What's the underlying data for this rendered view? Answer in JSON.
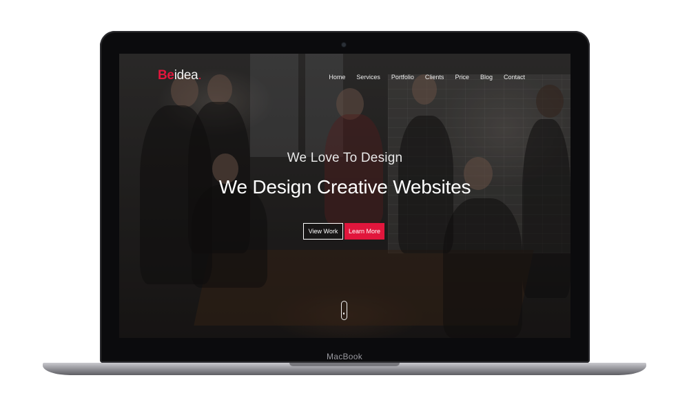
{
  "device": {
    "label": "MacBook"
  },
  "site": {
    "logo": {
      "accent": "Be",
      "rest": "idea",
      "dot": "."
    },
    "nav": [
      "Home",
      "Services",
      "Portfolio",
      "Clients",
      "Price",
      "Blog",
      "Contact"
    ],
    "hero": {
      "subtitle": "We Love To Design",
      "title": "We Design Creative Websites",
      "primary_button": "View Work",
      "secondary_button": "Learn More"
    }
  },
  "colors": {
    "accent": "#e1163c",
    "frame": "#0b0b0d",
    "text": "#ffffff"
  },
  "icons": {
    "scroll": "mouse-scroll-icon",
    "camera": "camera-icon"
  }
}
